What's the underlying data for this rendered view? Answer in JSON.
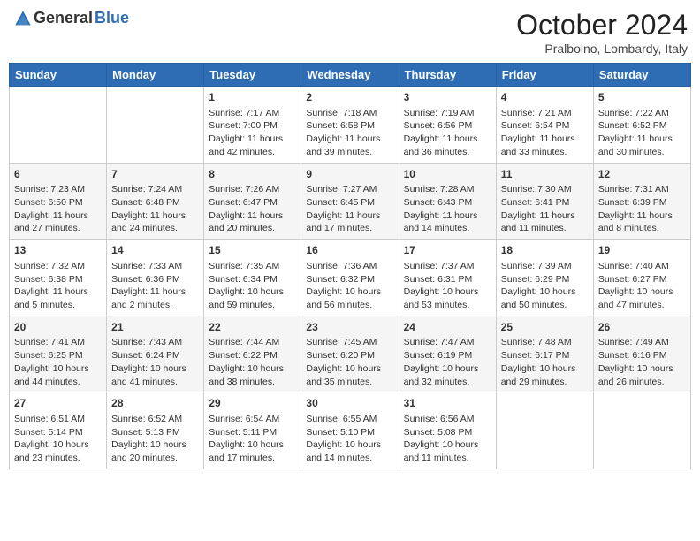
{
  "header": {
    "logo_general": "General",
    "logo_blue": "Blue",
    "month_year": "October 2024",
    "location": "Pralboino, Lombardy, Italy"
  },
  "days_of_week": [
    "Sunday",
    "Monday",
    "Tuesday",
    "Wednesday",
    "Thursday",
    "Friday",
    "Saturday"
  ],
  "weeks": [
    [
      {
        "day": "",
        "sunrise": "",
        "sunset": "",
        "daylight": ""
      },
      {
        "day": "",
        "sunrise": "",
        "sunset": "",
        "daylight": ""
      },
      {
        "day": "1",
        "sunrise": "Sunrise: 7:17 AM",
        "sunset": "Sunset: 7:00 PM",
        "daylight": "Daylight: 11 hours and 42 minutes."
      },
      {
        "day": "2",
        "sunrise": "Sunrise: 7:18 AM",
        "sunset": "Sunset: 6:58 PM",
        "daylight": "Daylight: 11 hours and 39 minutes."
      },
      {
        "day": "3",
        "sunrise": "Sunrise: 7:19 AM",
        "sunset": "Sunset: 6:56 PM",
        "daylight": "Daylight: 11 hours and 36 minutes."
      },
      {
        "day": "4",
        "sunrise": "Sunrise: 7:21 AM",
        "sunset": "Sunset: 6:54 PM",
        "daylight": "Daylight: 11 hours and 33 minutes."
      },
      {
        "day": "5",
        "sunrise": "Sunrise: 7:22 AM",
        "sunset": "Sunset: 6:52 PM",
        "daylight": "Daylight: 11 hours and 30 minutes."
      }
    ],
    [
      {
        "day": "6",
        "sunrise": "Sunrise: 7:23 AM",
        "sunset": "Sunset: 6:50 PM",
        "daylight": "Daylight: 11 hours and 27 minutes."
      },
      {
        "day": "7",
        "sunrise": "Sunrise: 7:24 AM",
        "sunset": "Sunset: 6:48 PM",
        "daylight": "Daylight: 11 hours and 24 minutes."
      },
      {
        "day": "8",
        "sunrise": "Sunrise: 7:26 AM",
        "sunset": "Sunset: 6:47 PM",
        "daylight": "Daylight: 11 hours and 20 minutes."
      },
      {
        "day": "9",
        "sunrise": "Sunrise: 7:27 AM",
        "sunset": "Sunset: 6:45 PM",
        "daylight": "Daylight: 11 hours and 17 minutes."
      },
      {
        "day": "10",
        "sunrise": "Sunrise: 7:28 AM",
        "sunset": "Sunset: 6:43 PM",
        "daylight": "Daylight: 11 hours and 14 minutes."
      },
      {
        "day": "11",
        "sunrise": "Sunrise: 7:30 AM",
        "sunset": "Sunset: 6:41 PM",
        "daylight": "Daylight: 11 hours and 11 minutes."
      },
      {
        "day": "12",
        "sunrise": "Sunrise: 7:31 AM",
        "sunset": "Sunset: 6:39 PM",
        "daylight": "Daylight: 11 hours and 8 minutes."
      }
    ],
    [
      {
        "day": "13",
        "sunrise": "Sunrise: 7:32 AM",
        "sunset": "Sunset: 6:38 PM",
        "daylight": "Daylight: 11 hours and 5 minutes."
      },
      {
        "day": "14",
        "sunrise": "Sunrise: 7:33 AM",
        "sunset": "Sunset: 6:36 PM",
        "daylight": "Daylight: 11 hours and 2 minutes."
      },
      {
        "day": "15",
        "sunrise": "Sunrise: 7:35 AM",
        "sunset": "Sunset: 6:34 PM",
        "daylight": "Daylight: 10 hours and 59 minutes."
      },
      {
        "day": "16",
        "sunrise": "Sunrise: 7:36 AM",
        "sunset": "Sunset: 6:32 PM",
        "daylight": "Daylight: 10 hours and 56 minutes."
      },
      {
        "day": "17",
        "sunrise": "Sunrise: 7:37 AM",
        "sunset": "Sunset: 6:31 PM",
        "daylight": "Daylight: 10 hours and 53 minutes."
      },
      {
        "day": "18",
        "sunrise": "Sunrise: 7:39 AM",
        "sunset": "Sunset: 6:29 PM",
        "daylight": "Daylight: 10 hours and 50 minutes."
      },
      {
        "day": "19",
        "sunrise": "Sunrise: 7:40 AM",
        "sunset": "Sunset: 6:27 PM",
        "daylight": "Daylight: 10 hours and 47 minutes."
      }
    ],
    [
      {
        "day": "20",
        "sunrise": "Sunrise: 7:41 AM",
        "sunset": "Sunset: 6:25 PM",
        "daylight": "Daylight: 10 hours and 44 minutes."
      },
      {
        "day": "21",
        "sunrise": "Sunrise: 7:43 AM",
        "sunset": "Sunset: 6:24 PM",
        "daylight": "Daylight: 10 hours and 41 minutes."
      },
      {
        "day": "22",
        "sunrise": "Sunrise: 7:44 AM",
        "sunset": "Sunset: 6:22 PM",
        "daylight": "Daylight: 10 hours and 38 minutes."
      },
      {
        "day": "23",
        "sunrise": "Sunrise: 7:45 AM",
        "sunset": "Sunset: 6:20 PM",
        "daylight": "Daylight: 10 hours and 35 minutes."
      },
      {
        "day": "24",
        "sunrise": "Sunrise: 7:47 AM",
        "sunset": "Sunset: 6:19 PM",
        "daylight": "Daylight: 10 hours and 32 minutes."
      },
      {
        "day": "25",
        "sunrise": "Sunrise: 7:48 AM",
        "sunset": "Sunset: 6:17 PM",
        "daylight": "Daylight: 10 hours and 29 minutes."
      },
      {
        "day": "26",
        "sunrise": "Sunrise: 7:49 AM",
        "sunset": "Sunset: 6:16 PM",
        "daylight": "Daylight: 10 hours and 26 minutes."
      }
    ],
    [
      {
        "day": "27",
        "sunrise": "Sunrise: 6:51 AM",
        "sunset": "Sunset: 5:14 PM",
        "daylight": "Daylight: 10 hours and 23 minutes."
      },
      {
        "day": "28",
        "sunrise": "Sunrise: 6:52 AM",
        "sunset": "Sunset: 5:13 PM",
        "daylight": "Daylight: 10 hours and 20 minutes."
      },
      {
        "day": "29",
        "sunrise": "Sunrise: 6:54 AM",
        "sunset": "Sunset: 5:11 PM",
        "daylight": "Daylight: 10 hours and 17 minutes."
      },
      {
        "day": "30",
        "sunrise": "Sunrise: 6:55 AM",
        "sunset": "Sunset: 5:10 PM",
        "daylight": "Daylight: 10 hours and 14 minutes."
      },
      {
        "day": "31",
        "sunrise": "Sunrise: 6:56 AM",
        "sunset": "Sunset: 5:08 PM",
        "daylight": "Daylight: 10 hours and 11 minutes."
      },
      {
        "day": "",
        "sunrise": "",
        "sunset": "",
        "daylight": ""
      },
      {
        "day": "",
        "sunrise": "",
        "sunset": "",
        "daylight": ""
      }
    ]
  ]
}
